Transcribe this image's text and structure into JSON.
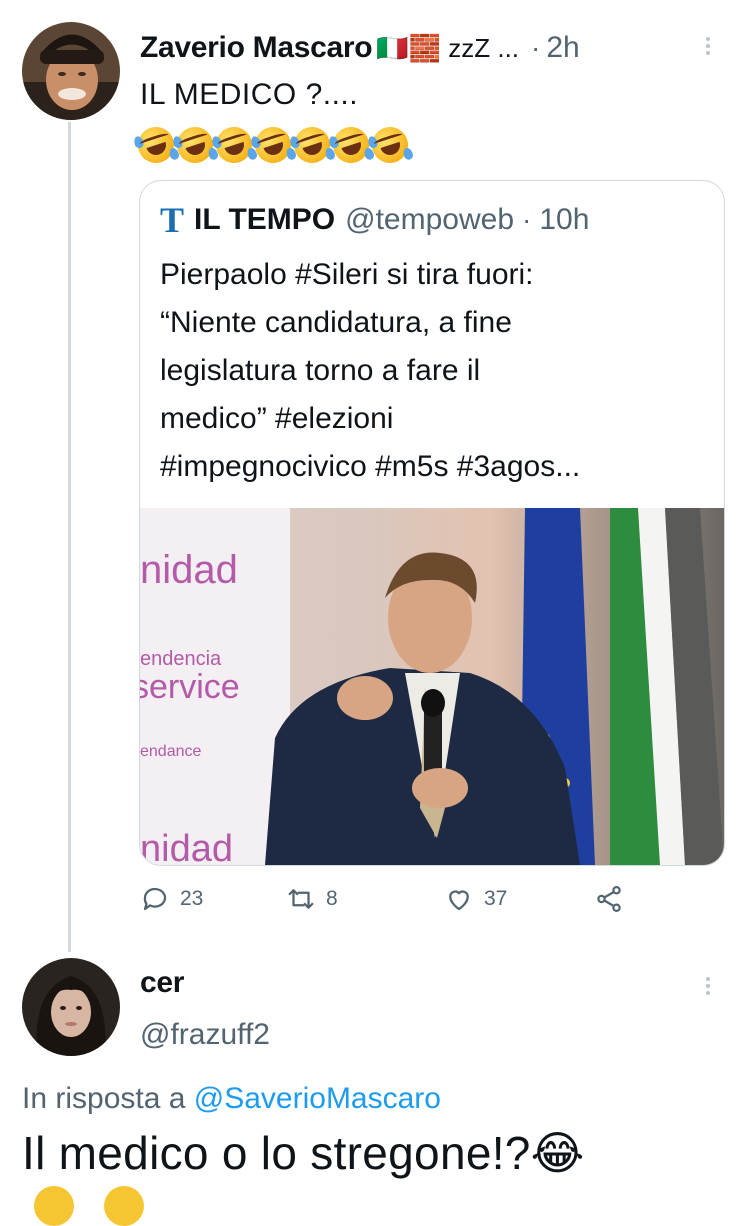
{
  "tweet": {
    "author_name": "Zaverio Mascaro",
    "author_name_suffix": "🇮🇹🧱 zzZ ...",
    "time_sep": "·",
    "time": "2h",
    "text": "IL MEDICO ?....",
    "emoji_count_label": "🤣🤣🤣🤣🤣🤣🤣"
  },
  "quoted": {
    "source_logo": "T",
    "source_name": "IL TEMPO",
    "handle": "@tempoweb",
    "time_sep": "·",
    "time": "10h",
    "lines": [
      "Pierpaolo #Sileri si tira fuori:",
      "“Niente candidatura, a fine",
      "legislatura torno a fare il",
      "medico” #elezioni",
      "#impegnocivico #m5s #3agos..."
    ],
    "photo_words": [
      "nidad",
      "endencia",
      "service",
      "endance",
      "nidad"
    ]
  },
  "actions": {
    "replies": "23",
    "retweets": "8",
    "likes": "37"
  },
  "reply": {
    "author_name": "cer",
    "handle": "@frazuff2",
    "in_reply_prefix": "In risposta a",
    "in_reply_handle": "@SaverioMascaro",
    "text": "Il medico o lo stregone!?😂"
  },
  "colors": {
    "link": "#1d9bf0",
    "muted": "#536471",
    "border": "#cfd9de"
  },
  "icons": [
    "more-icon",
    "reply-icon",
    "retweet-icon",
    "like-icon",
    "share-icon"
  ]
}
